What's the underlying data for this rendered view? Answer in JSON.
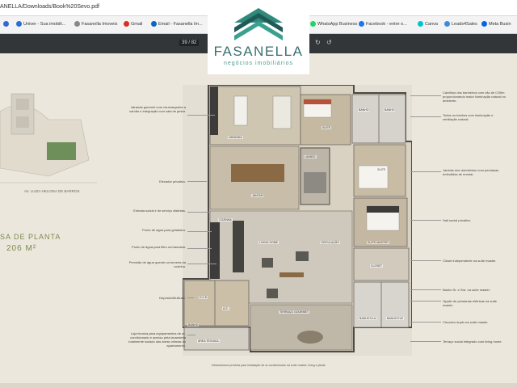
{
  "browser": {
    "url": "ANELLA/Downloads/Book%20Sevo.pdf",
    "bookmarks": [
      {
        "label": "Univer - Sua imobili...",
        "color": "#2a6fd6"
      },
      {
        "label": "Fasanella Imoveis",
        "color": "#888888"
      },
      {
        "label": "Gmail",
        "color": "#d93025"
      },
      {
        "label": "Email - Fasanella Im...",
        "color": "#0a66c2"
      },
      {
        "label": "WhatsApp Business",
        "color": "#25d366"
      },
      {
        "label": "Facebook - entre o...",
        "color": "#1877f2"
      },
      {
        "label": "Canva",
        "color": "#00c4cc"
      },
      {
        "label": "Leads4Sales",
        "color": "#3b8ddb"
      },
      {
        "label": "Meta Busin",
        "color": "#0668e1"
      }
    ]
  },
  "pdf_toolbar": {
    "page_current": "39",
    "page_total": "/ 82",
    "zoom_out_icon": "minus-icon",
    "zoom_in_icon": "plus-icon",
    "rotate_icon": "rotate-icon",
    "history_icon": "history-icon"
  },
  "logo": {
    "name": "FASANELLA",
    "tagline": "negócios imobiliários",
    "colors": {
      "dark": "#1f5a57",
      "light": "#3ba08f"
    }
  },
  "page": {
    "street": "AV. LUIZA HELOISA DE BARROS",
    "title_line1": "SA DE PLANTA",
    "title_line2": "206 M²",
    "rooms": {
      "varanda": "VARANDA",
      "suite1": "SUITE",
      "banho1": "BANHO",
      "banho2": "BANHO",
      "jantar": "JANTAR",
      "lavabo": "LAVABO",
      "suite2": "SUITE",
      "cozinha": "COZINHA",
      "living": "LIVING HOME",
      "circulacao": "CIRCULAÇÃO",
      "suite_master": "SUITE MASTER",
      "closet": "CLOSET",
      "dce": "D.C.E",
      "as": "A.S.",
      "terraco": "TERRAÇO GOURMET",
      "banho3": "BANHO",
      "banho4": "BANHO ELA",
      "banho5": "BANHO ELE",
      "area_tecnica": "ÁREA TÉCNICA"
    },
    "left_annotations": [
      "Varanda gourmet com churrasqueira a carvão e integração com sala de jantar.",
      "Elevador privativo.",
      "Entrada social e de serviço distintas.",
      "Ponto de água para geladeira.",
      "Ponto de água para filtro na bancada.",
      "Previsão de água quente na torneira da cozinha.",
      "Depósito/Multiuso.",
      "Loja técnica para equipamentos de ar-condicionado e acesso pela lavanderia totalmente isolado das áreas íntimas do apartamento."
    ],
    "right_annotations": [
      "Caixilhos dos banheiros com vão de 0,50m proporcionando maior iluminação natural no ambiente.",
      "Todos os banhos com iluminação e ventilação natural.",
      "Janelas dos dormitórios com persianas embutidas de enrolar.",
      "Hall social privativo.",
      "Closet independente na suíte master.",
      "Banho Sr. e Sra. na suíte master.",
      "Opção de persianas elétricas na suíte master.",
      "Chuveiro duplo na suíte master.",
      "Terraço social integrado com living home."
    ],
    "footnote": "Infraestrutura prevista para instalação de ar-condicionado na suíte master, living e jantar."
  }
}
